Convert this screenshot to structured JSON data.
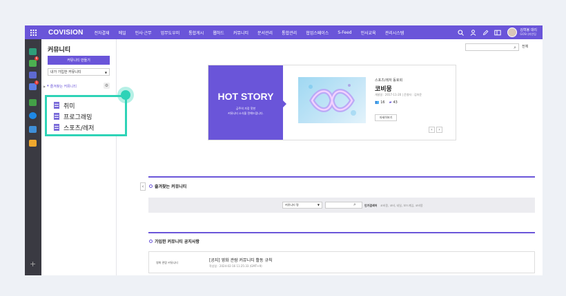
{
  "colors": {
    "primary": "#6a55d9",
    "highlight": "#2ed3b7",
    "rail": "#3a3a42"
  },
  "nav": {
    "brand": "COVISION",
    "items": [
      "전자결재",
      "메일",
      "인사·근무",
      "업무도우미",
      "통합게시",
      "웹하드",
      "커뮤니티",
      "문서관리",
      "통합관리",
      "협업스페이스",
      "S-Feed",
      "인사교육",
      "관리시스템"
    ],
    "icons": [
      "search-icon",
      "user-icon",
      "edit-icon",
      "window-icon"
    ],
    "user_name": "김혁봉 대리",
    "user_org": "GOS디자인팀"
  },
  "rail": {
    "icons": [
      "inbox-icon",
      "bell-icon",
      "checklist-icon",
      "calendar-icon",
      "note-icon",
      "cloud-icon",
      "people-icon",
      "card-icon"
    ],
    "badges": [
      "6",
      "1"
    ],
    "add_label": "+"
  },
  "side": {
    "title": "커뮤니티",
    "create_button": "커뮤니티 만들기",
    "select_value": "내가 가입한 커뮤니티",
    "favorites_label": "즐겨찾는 커뮤니티",
    "highlight_items": [
      "취미",
      "프로그래밍",
      "스포츠/레저"
    ]
  },
  "search": {
    "scope": "전체"
  },
  "hero": {
    "title": "HOT STORY",
    "sub1": "금주의 가장 핫한",
    "sub2": "커뮤니티 소식을 전해드립니다.",
    "category": "스포츠/레저 동호회",
    "name": "코비몽",
    "meta": "개설일 : 2017-11-20 | 운영자 : 김하윤",
    "members": "16",
    "posts": "43",
    "visit_button": "자세히보기",
    "prev": "‹",
    "next": "›"
  },
  "favorites_section": {
    "title": "즐겨찾는 커뮤니티",
    "select_value": "커뮤니티 명",
    "popular_label": "인기검색어",
    "popular_tags": "코비몽, 코비, 네일, 보드게임, 코비몽"
  },
  "notice_section": {
    "title": "가입한 커뮤니티 공지사항",
    "community": "영화 관람 커뮤니티",
    "post_title": "[공지] 영화 관람 커뮤니티 활동 규칙",
    "post_meta": "작성일 : 2024-02-16 11:25:33 (GMT+9)"
  }
}
